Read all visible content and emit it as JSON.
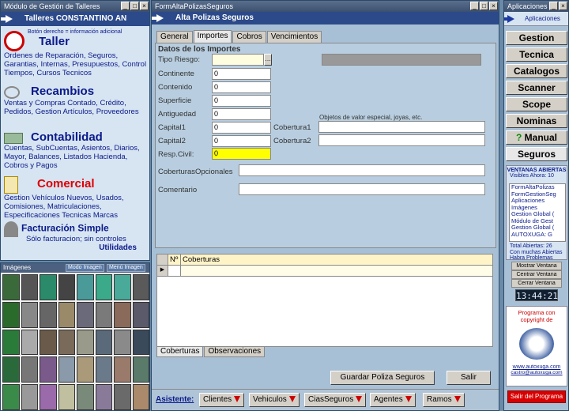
{
  "left": {
    "window_title": "Módulo de Gestión de Talleres",
    "header": "Talleres CONSTANTINO AN",
    "hint": "Botón derecho = información adicional",
    "sections": [
      {
        "title": "Taller",
        "desc": "Ordenes de Reparación, Seguros, Garantias, Internas, Presupuestos, Control Tiempos, Cursos Tecnicos"
      },
      {
        "title": "Recambios",
        "desc": "Ventas y Compras Contado, Crédito, Pedidos, Gestion Artículos, Proveedores"
      },
      {
        "title": "Contabilidad",
        "desc": "Cuentas, SubCuentas, Asientos, Diarios, Mayor, Balances, Listados Hacienda, Cobros y Pagos"
      },
      {
        "title": "Comercial",
        "desc": "Gestion Vehículos Nuevos, Usados, Comisiones, Matriculaciones, Especificaciones Tecnicas Marcas"
      },
      {
        "title": "Facturación Simple",
        "desc": "Sólo facturacion; sin controles"
      }
    ],
    "utilidades": "Utilidades"
  },
  "images": {
    "title": "Imágenes",
    "mode_label": "Modo Imagen",
    "menu_label": "Menú Imagen"
  },
  "form": {
    "window_title": "FormAltaPolizasSeguros",
    "header": "Alta Polizas Seguros",
    "tabs": [
      "General",
      "Importes",
      "Cobros",
      "Vencimientos"
    ],
    "section_title": "Datos de los Importes",
    "labels": {
      "tipo_riesgo": "Tipo Riesgo:",
      "continente": "Continente",
      "contenido": "Contenido",
      "superficie": "Superficie",
      "antiguedad": "Antiguedad",
      "capital1": "Capital1",
      "capital2": "Capital2",
      "resp_civil": "Resp.Civil:",
      "cobertura1": "Cobertura1",
      "cobertura2": "Cobertura2",
      "objetos": "Objetos de valor especial, joyas, etc.",
      "coberturas_opcionales": "CoberturasOpcionales",
      "comentario": "Comentario"
    },
    "values": {
      "continente": "0",
      "contenido": "0",
      "superficie": "0",
      "antiguedad": "0",
      "capital1": "0",
      "capital2": "0",
      "resp_civil": "0"
    },
    "grid_headers": [
      "Nº",
      "Coberturas"
    ],
    "bottom_tabs": [
      "Coberturas",
      "Observaciones"
    ],
    "save_label": "Guardar Poliza Seguros",
    "exit_label": "Salir",
    "assistant_label": "Asistente:",
    "assistant_buttons": [
      "Clientes",
      "Vehiculos",
      "CiasSeguros",
      "Agentes",
      "Ramos"
    ]
  },
  "right": {
    "window_title": "Aplicaciones",
    "header": "Aplicaciones",
    "buttons": [
      "Gestion",
      "Tecnica",
      "Catalogos",
      "Scanner",
      "Scope",
      "Nominas",
      "Manual",
      "Seguros"
    ],
    "open_windows_title": "VENTANAS ABIERTAS",
    "visible_now": "Visibles Ahora: 10",
    "open_windows": [
      "FormAltaPolizas",
      "FormGestionSeg",
      "Aplicaciones",
      "Imágenes",
      "Gestion Global (",
      "Módulo de Gest",
      "Gestion Global (",
      "AUTOXUGA: G"
    ],
    "total_open": "Total Abiertas: 26",
    "many_open": "Con muchas Abiertas",
    "problems": "Habra Problemas",
    "show_btn": "Mostrar Ventana",
    "center_btn": "Centrar Ventana",
    "close_btn": "Cerrar Ventana",
    "clock": "13:44:21",
    "copyright1": "Programa con",
    "copyright2": "copyright de",
    "url": "www.autoxuga.com",
    "email": "castro@autoxuga.com",
    "exit_program": "Salir del Programa"
  }
}
